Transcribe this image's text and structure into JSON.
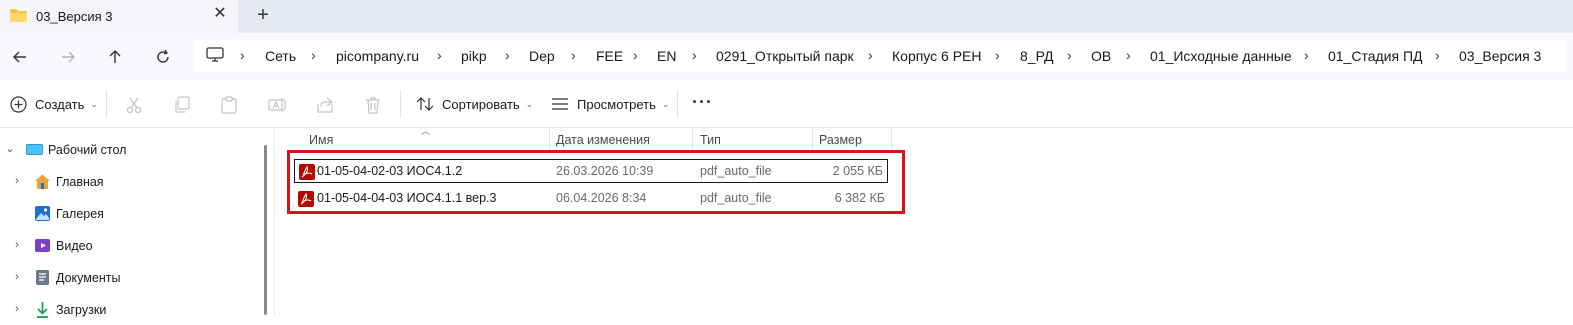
{
  "window": {
    "tab_title": "03_Версия 3",
    "close_glyph": "✕",
    "newtab_glyph": "+"
  },
  "breadcrumb": {
    "items": [
      "Сеть",
      "picompany.ru",
      "pikp",
      "Dep",
      "FEE",
      "EN",
      "0291_Открытый парк",
      "Корпус 6 РЕН",
      "8_РД",
      "ОВ",
      "01_Исходные данные",
      "01_Стадия ПД",
      "03_Версия 3"
    ],
    "separator": "›"
  },
  "toolbar": {
    "create_label": "Создать",
    "sort_label": "Сортировать",
    "view_label": "Просмотреть",
    "more_glyph": "···"
  },
  "sidebar": {
    "items": [
      {
        "label": "Рабочий стол",
        "icon": "desktop-icon",
        "expanded": true
      },
      {
        "label": "Главная",
        "icon": "home-icon"
      },
      {
        "label": "Галерея",
        "icon": "gallery-icon"
      },
      {
        "label": "Видео",
        "icon": "video-icon"
      },
      {
        "label": "Документы",
        "icon": "documents-icon"
      },
      {
        "label": "Загрузки",
        "icon": "downloads-icon"
      }
    ]
  },
  "filelist": {
    "columns": {
      "name": "Имя",
      "modified": "Дата изменения",
      "type": "Тип",
      "size": "Размер"
    },
    "rows": [
      {
        "name": "01-05-04-02-03 ИОС4.1.2",
        "modified": "26.03.2026 10:39",
        "type": "pdf_auto_file",
        "size": "2 055 КБ",
        "focused": true
      },
      {
        "name": "01-05-04-04-03 ИОС4.1.1 вер.3",
        "modified": "06.04.2026 8:34",
        "type": "pdf_auto_file",
        "size": "6 382 КБ",
        "focused": false
      }
    ]
  },
  "colors": {
    "highlight_border": "#e01020",
    "pdf_red": "#b30b00",
    "accent_blue": "#1a73c8"
  }
}
